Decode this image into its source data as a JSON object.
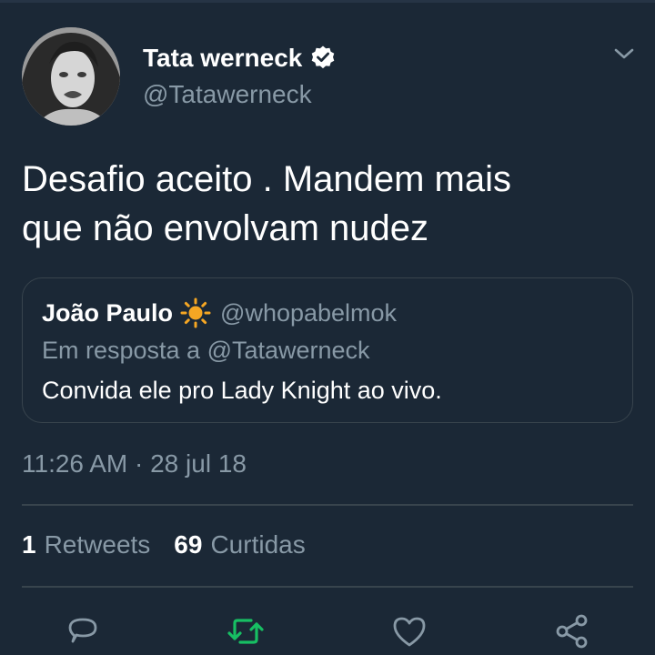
{
  "author": {
    "display_name": "Tata werneck",
    "handle": "@Tatawerneck",
    "verified_icon": "verified-badge-icon",
    "avatar_icon": "profile-photo"
  },
  "tweet": {
    "text_lines": [
      "Desafio aceito . Mandem mais",
      "que não envolvam nudez"
    ],
    "timestamp": "11:26 AM · 28 jul 18"
  },
  "quoted_tweet": {
    "display_name": "João Paulo",
    "emoji_icon": "sun-icon",
    "handle": "@whopabelmok",
    "reply_context": "Em resposta a @Tatawerneck",
    "text": "Convida ele pro Lady Knight ao vivo."
  },
  "stats": {
    "retweets_count": "1",
    "retweets_label": "Retweets",
    "likes_count": "69",
    "likes_label": "Curtidas"
  },
  "actions": [
    "reply-icon",
    "retweet-icon",
    "like-icon",
    "share-icon"
  ],
  "colors": {
    "background": "#1b2836",
    "primary_text": "#ffffff",
    "secondary_text": "#8899a6",
    "border": "#38444d",
    "retweet_active": "#17bf63",
    "sun": "#f5a623"
  }
}
